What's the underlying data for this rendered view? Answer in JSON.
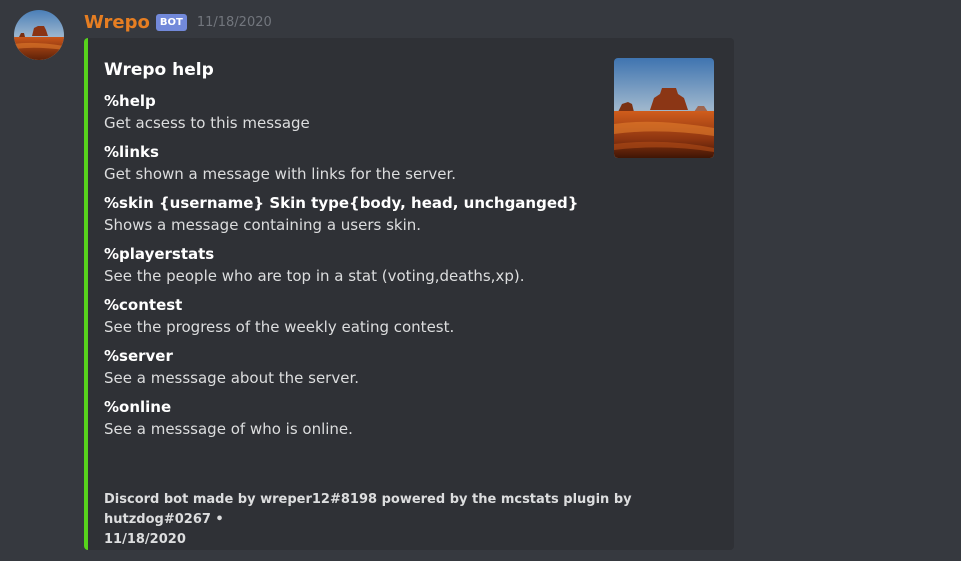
{
  "message": {
    "username": "Wrepo",
    "bot_tag": "BOT",
    "timestamp": "11/18/2020",
    "username_color": "#e67e22",
    "avatar_image": "desert-mesa-landscape"
  },
  "embed": {
    "accent_color": "#57d31c",
    "title": "Wrepo help",
    "thumbnail_image": "desert-mesa-landscape",
    "fields": [
      {
        "name": "%help",
        "value": "Get acsess to this message"
      },
      {
        "name": "%links",
        "value": "Get shown a message with links for the server."
      },
      {
        "name": "%skin {username} Skin type{body, head, unchganged}",
        "value": "Shows a message containing a users skin."
      },
      {
        "name": "%playerstats",
        "value": "See the people who are top in a stat (voting,deaths,xp)."
      },
      {
        "name": "%contest",
        "value": "See the progress of the weekly eating contest."
      },
      {
        "name": "%server",
        "value": "See a messsage about the server."
      },
      {
        "name": "%online",
        "value": "See a messsage of who is online."
      }
    ],
    "footer": {
      "text": "Discord bot made by wreper12#8198 powered by the mcstats plugin by hutzdog#0267 •",
      "timestamp": "11/18/2020"
    }
  }
}
